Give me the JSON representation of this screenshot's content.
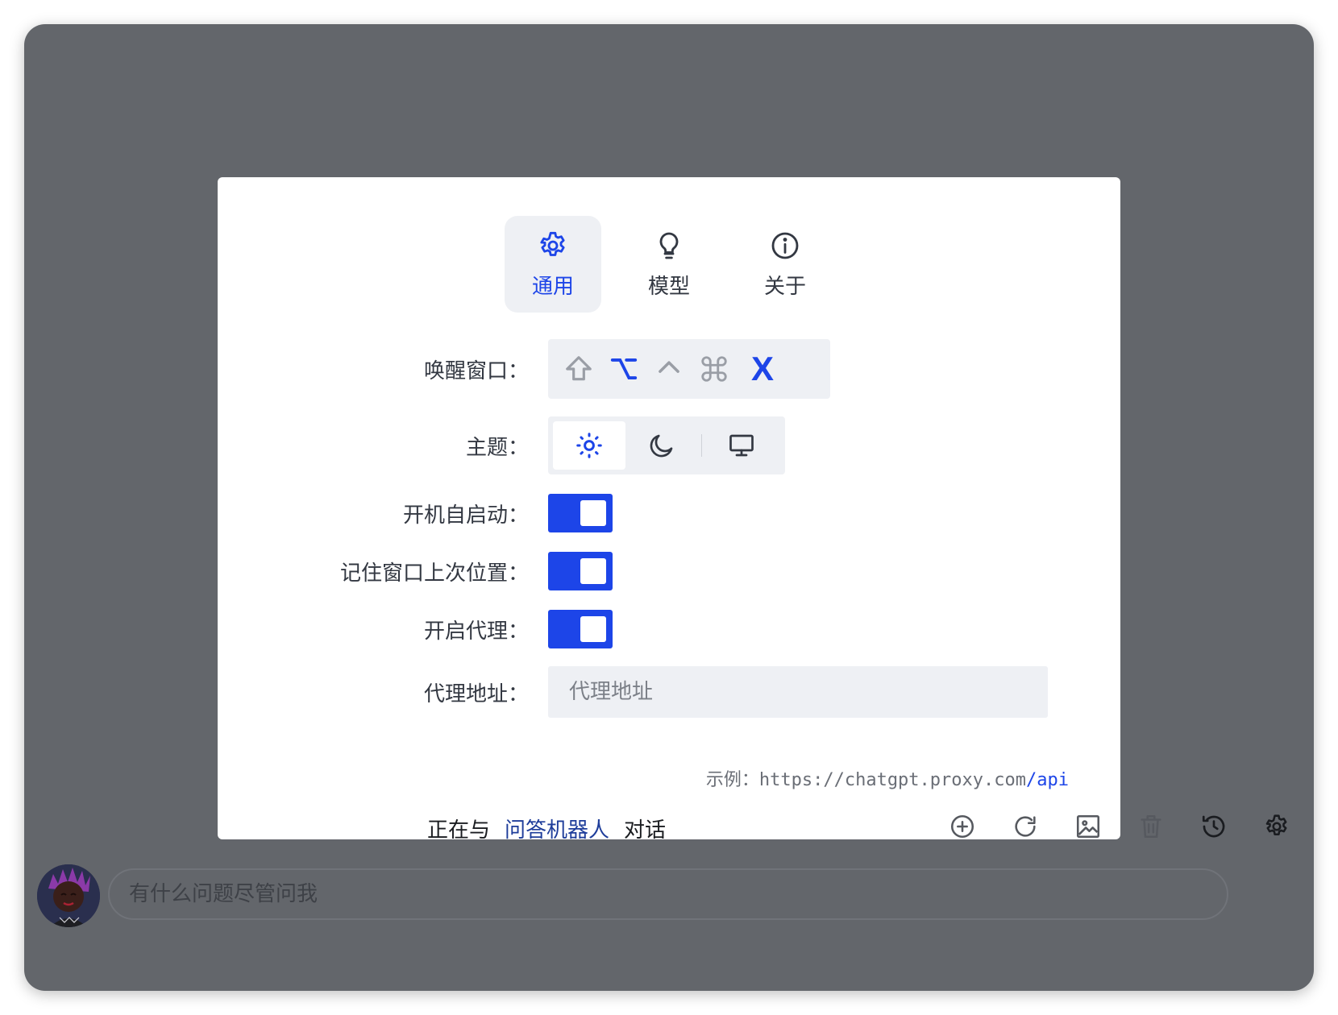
{
  "colors": {
    "accent": "#1d45e8",
    "overlay": "#63666b",
    "panel": "#ffffff",
    "field_bg": "#eef0f4"
  },
  "settings": {
    "tabs": [
      {
        "label": "通用",
        "icon": "gear-icon",
        "active": true
      },
      {
        "label": "模型",
        "icon": "lightbulb-icon",
        "active": false
      },
      {
        "label": "关于",
        "icon": "info-icon",
        "active": false
      }
    ],
    "shortcut": {
      "label": "唤醒窗口：",
      "keys": [
        "shift-key-icon",
        "option-key-icon",
        "control-key-icon",
        "command-key-icon"
      ],
      "letter": "X"
    },
    "theme": {
      "label": "主题：",
      "options": [
        "sun-icon",
        "moon-icon",
        "monitor-icon"
      ],
      "selected": "sun-icon"
    },
    "autostart": {
      "label": "开机自启动：",
      "on": true
    },
    "remember_position": {
      "label": "记住窗口上次位置：",
      "on": true
    },
    "proxy_enabled": {
      "label": "开启代理：",
      "on": true
    },
    "proxy_address": {
      "label": "代理地址：",
      "placeholder": "代理地址",
      "value": ""
    },
    "example": {
      "prefix": "示例：",
      "url": "https://chatgpt.proxy.com",
      "suffix": "/api"
    }
  },
  "status": {
    "before": "正在与",
    "bot": "问答机器人",
    "after": "对话"
  },
  "toolbar": [
    "add-circle-icon",
    "refresh-icon",
    "image-icon",
    "trash-icon",
    "history-icon",
    "gear-icon"
  ],
  "chat": {
    "placeholder": "有什么问题尽管问我"
  }
}
